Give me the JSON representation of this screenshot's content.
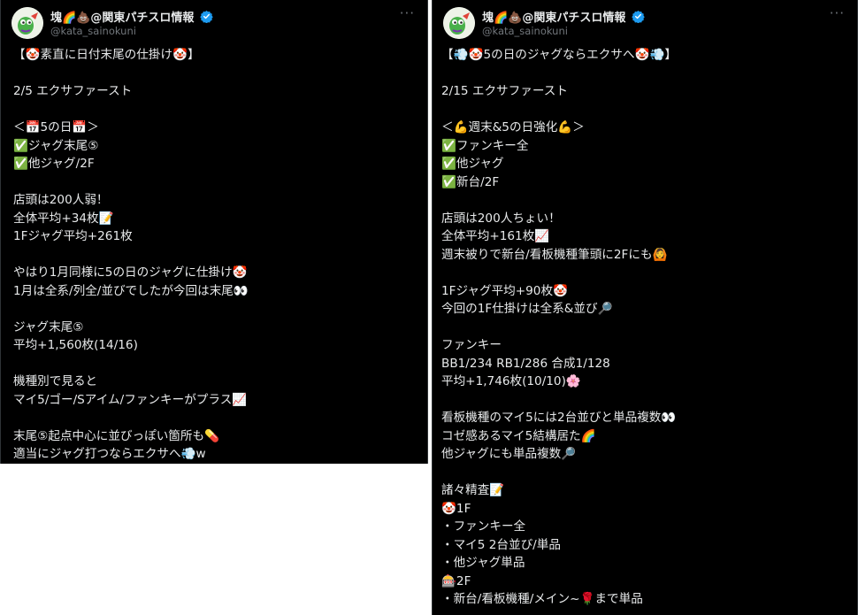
{
  "account": {
    "display_name": "塊🌈💩@関東パチスロ情報",
    "handle": "@kata_sainokuni"
  },
  "icons": {
    "more": "more-options-icon",
    "verified": "verified-badge-icon",
    "avatar": "avatar"
  },
  "colors": {
    "post_background": "#000000",
    "text": "#e7e9ea",
    "secondary_text": "#71767b",
    "verified_blue": "#1d9bf0"
  },
  "post_left": {
    "more_label": "···",
    "lines": [
      "【🤡素直に日付末尾の仕掛け🤡】",
      "",
      "2/5 エクサファースト",
      "",
      "＜📅5の日📅＞",
      "✅ジャグ末尾⑤",
      "✅他ジャグ/2F",
      "",
      "店頭は200人弱！",
      "全体平均+34枚📝",
      "1Fジャグ平均+261枚",
      "",
      "やはり1月同様に5の日のジャグに仕掛け🤡",
      "1月は全系/列全/並びでしたが今回は末尾👀",
      "",
      "ジャグ末尾⑤",
      "平均+1,560枚(14/16)",
      "",
      "機種別で見ると",
      "マイ5/ゴー/Sアイム/ファンキーがプラス📈",
      "",
      "末尾⑤起点中心に並びっぽい箇所も💊",
      "適当にジャグ打つならエクサへ💨w"
    ]
  },
  "post_right": {
    "more_label": "···",
    "lines": [
      "【💨🤡5の日のジャグならエクサへ🤡💨】",
      "",
      "2/15 エクサファースト",
      "",
      "＜💪週末&5の日強化💪＞",
      "✅ファンキー全",
      "✅他ジャグ",
      "✅新台/2F",
      "",
      "店頭は200人ちょい！",
      "全体平均+161枚📈",
      "週末被りで新台/看板機種筆頭に2Fにも🙆",
      "",
      "1Fジャグ平均+90枚🤡",
      "今回の1F仕掛けは全系&並び🔎",
      "",
      "ファンキー",
      "BB1/234 RB1/286 合成1/128",
      "平均+1,746枚(10/10)🌸",
      "",
      "看板機種のマイ5には2台並びと単品複数👀",
      "コゼ感あるマイ5結構居た🌈",
      "他ジャグにも単品複数🔎",
      "",
      "諸々精査📝",
      "🤡1F",
      "・ファンキー全",
      "・マイ5 2台並び/単品",
      "・他ジャグ単品",
      "🎰2F",
      "・新台/看板機種/メイン~🌹まで単品"
    ]
  }
}
